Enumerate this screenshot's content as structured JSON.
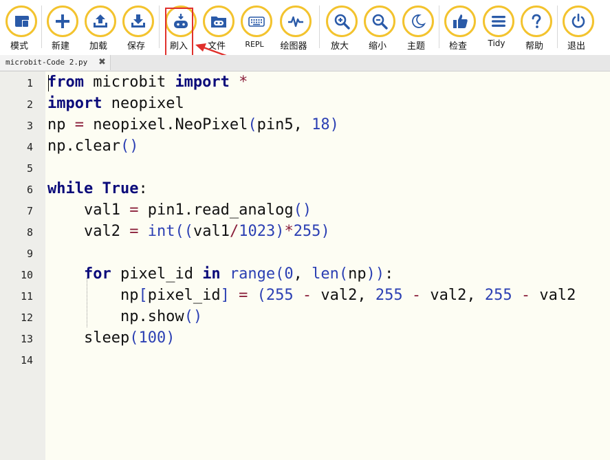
{
  "toolbar": {
    "buttons": [
      {
        "id": "mode",
        "label": "模式",
        "icon": "mode-icon"
      },
      {
        "id": "new",
        "label": "新建",
        "icon": "plus-icon"
      },
      {
        "id": "load",
        "label": "加载",
        "icon": "upload-icon"
      },
      {
        "id": "save",
        "label": "保存",
        "icon": "download-icon"
      },
      {
        "id": "flash",
        "label": "刷入",
        "icon": "flash-icon"
      },
      {
        "id": "files",
        "label": "文件",
        "icon": "files-icon"
      },
      {
        "id": "repl",
        "label": "REPL",
        "icon": "keyboard-icon"
      },
      {
        "id": "plotter",
        "label": "绘图器",
        "icon": "plotter-wave-icon"
      },
      {
        "id": "zoom_in",
        "label": "放大",
        "icon": "zoom-in-icon"
      },
      {
        "id": "zoom_out",
        "label": "缩小",
        "icon": "zoom-out-icon"
      },
      {
        "id": "theme",
        "label": "主题",
        "icon": "moon-icon"
      },
      {
        "id": "check",
        "label": "检查",
        "icon": "thumbs-up-icon"
      },
      {
        "id": "tidy",
        "label": "Tidy",
        "icon": "tidy-lines-icon"
      },
      {
        "id": "help",
        "label": "帮助",
        "icon": "question-icon"
      },
      {
        "id": "quit",
        "label": "退出",
        "icon": "power-icon"
      }
    ]
  },
  "tab": {
    "filename": "microbit-Code 2.py",
    "close_glyph": "✖"
  },
  "editor": {
    "line_numbers": [
      "1",
      "2",
      "3",
      "4",
      "5",
      "6",
      "7",
      "8",
      "9",
      "10",
      "11",
      "12",
      "13",
      "14"
    ],
    "lines": [
      "from microbit import *",
      "import neopixel",
      "np = neopixel.NeoPixel(pin5, 18)",
      "np.clear()",
      "",
      "while True:",
      "    val1 = pin1.read_analog()",
      "    val2 = int((val1/1023)*255)",
      "",
      "    for pixel_id in range(0, len(np)):",
      "        np[pixel_id] = (255 - val2, 255 - val2, 255 - val2",
      "        np.show()",
      "    sleep(100)",
      ""
    ]
  },
  "colors": {
    "accent": "#f3c32e",
    "icon": "#2a5aa8",
    "highlight": "#e0302c",
    "editor_bg": "#fdfdf3"
  }
}
